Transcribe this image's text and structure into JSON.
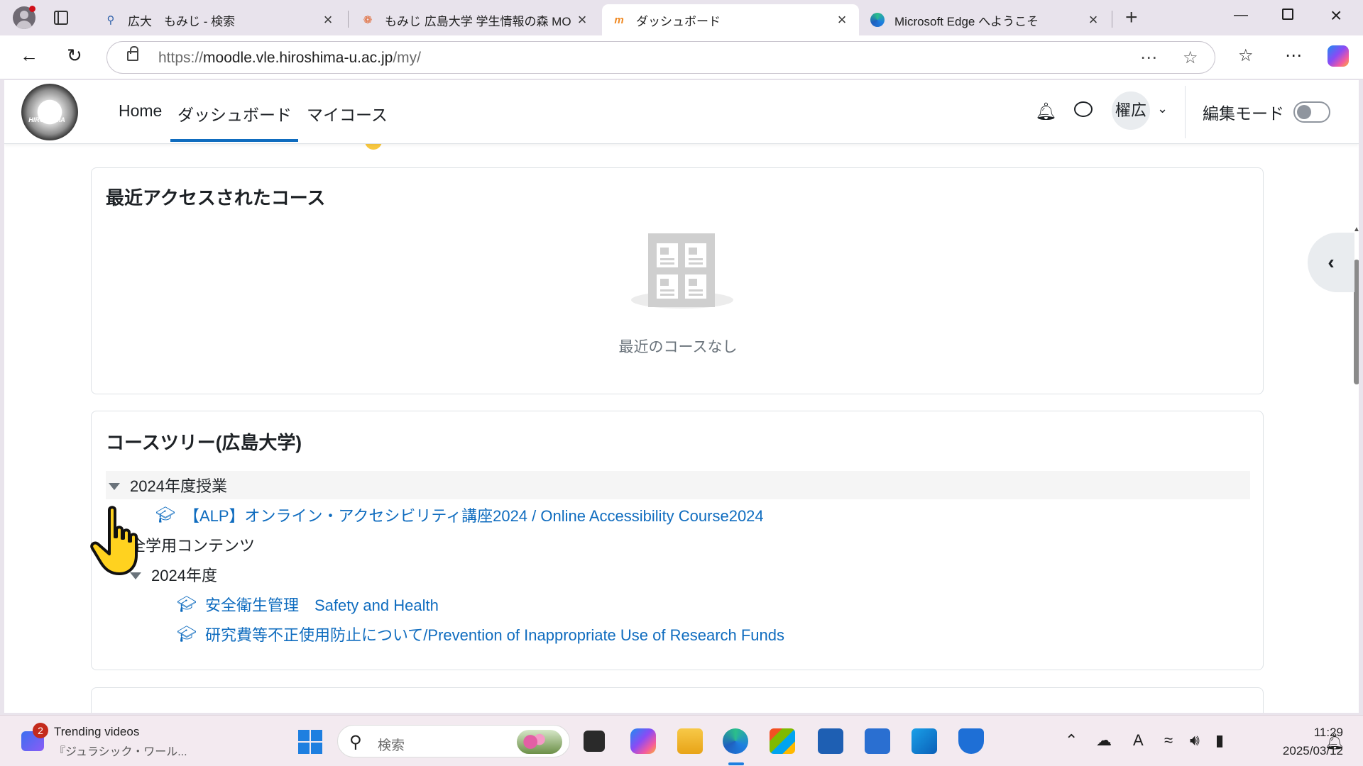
{
  "browser": {
    "tabs": [
      {
        "title": "広大　もみじ - 検索",
        "icon": "search-favicon"
      },
      {
        "title": "もみじ 広島大学 学生情報の森 MO",
        "icon": "momiji-leaf-favicon"
      },
      {
        "title": "ダッシュボード",
        "icon": "moodle-favicon"
      },
      {
        "title": "Microsoft Edge へようこそ",
        "icon": "edge-favicon"
      }
    ],
    "url_prefix": "https://",
    "url_host": "moodle.vle.hiroshima-u.ac.jp",
    "url_path": "/my/"
  },
  "moodle": {
    "logo_text": "HIROSHIMA",
    "nav": {
      "home": "Home",
      "dashboard": "ダッシュボード",
      "mycourses": "マイコース"
    },
    "user_initials": "櫂広",
    "edit_mode_label": "編集モード",
    "edit_mode_on": false
  },
  "recent_courses": {
    "title": "最近アクセスされたコース",
    "empty_text": "最近のコースなし"
  },
  "course_tree": {
    "title": "コースツリー(広島大学)",
    "category_1": "2024年度授業",
    "course_1": "【ALP】オンライン・アクセシビリティ講座2024 / Online Accessibility Course2024",
    "category_2": "全学用コンテンツ",
    "subcategory_2_1": "2024年度",
    "course_2": "安全衛生管理　Safety and Health",
    "course_3": "研究費等不正使用防止について/Prevention of Inappropriate Use of Research Funds"
  },
  "help_label": "?",
  "taskbar": {
    "widget_badge": "2",
    "widget_title": "Trending videos",
    "widget_subtitle": "『ジュラシック・ワール...",
    "search_placeholder": "検索",
    "time": "11:29",
    "date": "2025/03/12"
  }
}
